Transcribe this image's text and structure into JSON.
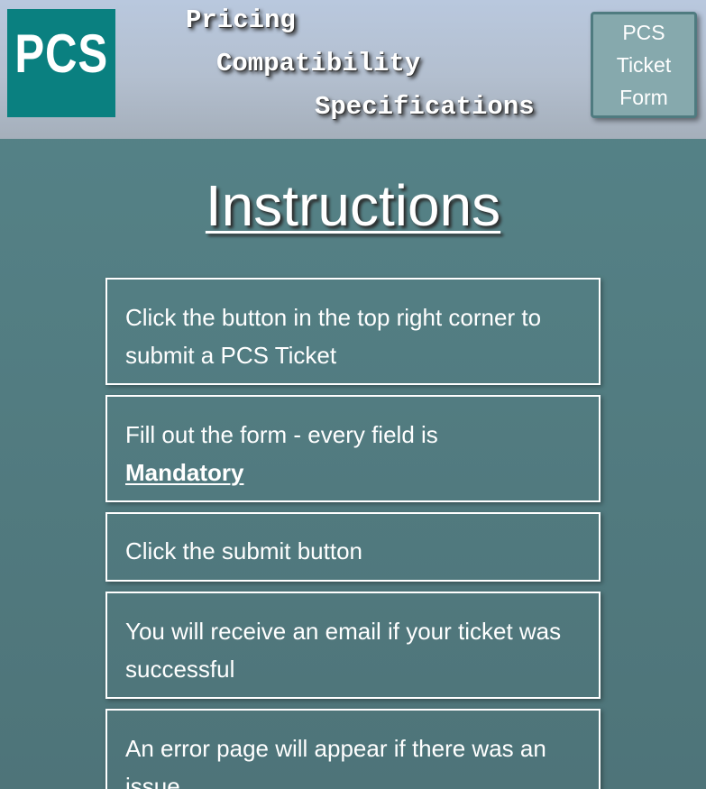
{
  "header": {
    "logo_text": "PCS",
    "tagline": [
      "Pricing",
      "Compatibility",
      "Specifications"
    ],
    "ticket_button": [
      "PCS",
      "Ticket",
      "Form"
    ]
  },
  "main": {
    "title": "Instructions",
    "steps": [
      {
        "text": "Click the button in the top right corner to submit a PCS Ticket"
      },
      {
        "text": "Fill out the form - every field is ",
        "emphasis": "Mandatory"
      },
      {
        "text": "Click the submit button"
      },
      {
        "text": "You will receive an email if your ticket was successful"
      },
      {
        "text": "An error page will appear if there was an issue"
      }
    ]
  },
  "colors": {
    "background": "#528086",
    "header": "#b6c4d6",
    "logo": "#0a8080",
    "button": "#86a9ad",
    "text": "#ffffff"
  }
}
